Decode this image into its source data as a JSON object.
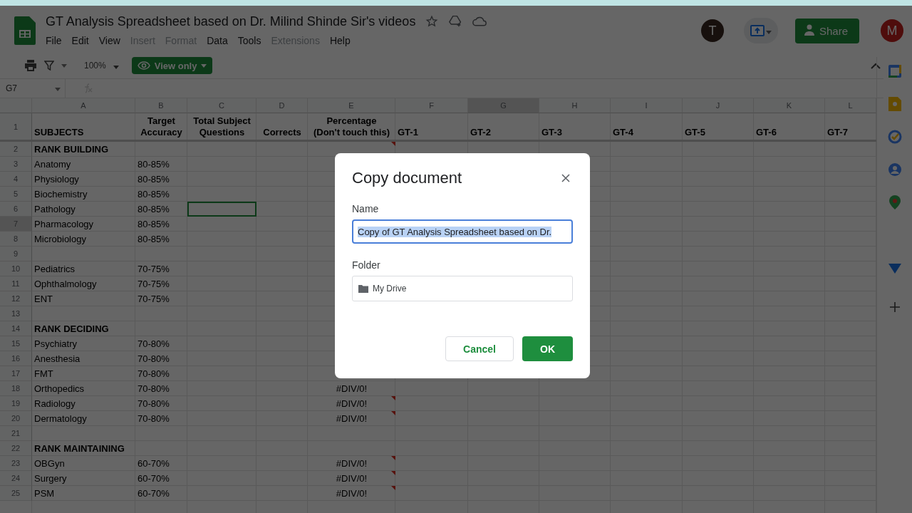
{
  "document": {
    "title": "GT Analysis Spreadsheet based on Dr. Milind Shinde Sir's videos"
  },
  "menu": [
    {
      "label": "File",
      "disabled": false
    },
    {
      "label": "Edit",
      "disabled": false
    },
    {
      "label": "View",
      "disabled": false
    },
    {
      "label": "Insert",
      "disabled": true
    },
    {
      "label": "Format",
      "disabled": true
    },
    {
      "label": "Data",
      "disabled": false
    },
    {
      "label": "Tools",
      "disabled": false
    },
    {
      "label": "Extensions",
      "disabled": true
    },
    {
      "label": "Help",
      "disabled": false
    }
  ],
  "account": {
    "collaborator_initial": "T",
    "user_initial": "M",
    "share_label": "Share"
  },
  "toolbar": {
    "zoom": "100%",
    "mode": "View only"
  },
  "name_box": "G7",
  "columns": [
    {
      "label": "A",
      "selected": false
    },
    {
      "label": "B",
      "selected": false
    },
    {
      "label": "C",
      "selected": false
    },
    {
      "label": "D",
      "selected": false
    },
    {
      "label": "E",
      "selected": false
    },
    {
      "label": "F",
      "selected": false
    },
    {
      "label": "G",
      "selected": true
    },
    {
      "label": "H",
      "selected": false
    },
    {
      "label": "I",
      "selected": false
    },
    {
      "label": "J",
      "selected": false
    },
    {
      "label": "K",
      "selected": false
    },
    {
      "label": "L",
      "selected": false
    }
  ],
  "header_row": {
    "number": "1",
    "cells": [
      "SUBJECTS",
      "Target\nAccuracy",
      "Total Subject\nQuestions",
      "Corrects",
      "Percentage\n(Don't touch this)",
      "GT-1",
      "GT-2",
      "GT-3",
      "GT-4",
      "GT-5",
      "GT-6",
      "GT-7"
    ]
  },
  "rows": [
    {
      "number": "2",
      "kind": "section",
      "a": "RANK BUILDING",
      "selected": false,
      "c_selected": false,
      "note": true
    },
    {
      "number": "3",
      "kind": "subject",
      "a": "Anatomy",
      "b": "80-85%",
      "selected": false,
      "c_selected": false,
      "note": false
    },
    {
      "number": "4",
      "kind": "subject",
      "a": "Physiology",
      "b": "80-85%",
      "selected": false,
      "c_selected": false,
      "note": false
    },
    {
      "number": "5",
      "kind": "subject",
      "a": "Biochemistry",
      "b": "80-85%",
      "selected": false,
      "c_selected": false,
      "note": false
    },
    {
      "number": "6",
      "kind": "subject",
      "a": "Pathology",
      "b": "80-85%",
      "selected": false,
      "c_selected": true,
      "note": false
    },
    {
      "number": "7",
      "kind": "subject",
      "a": "Pharmacology",
      "b": "80-85%",
      "selected": true,
      "c_selected": false,
      "note": false
    },
    {
      "number": "8",
      "kind": "subject",
      "a": "Microbiology",
      "b": "80-85%",
      "selected": false,
      "c_selected": false,
      "note": false
    },
    {
      "number": "9",
      "kind": "subject",
      "selected": false,
      "c_selected": false,
      "note": false
    },
    {
      "number": "10",
      "kind": "subject",
      "a": "Pediatrics",
      "b": "70-75%",
      "selected": false,
      "c_selected": false,
      "note": false
    },
    {
      "number": "11",
      "kind": "subject",
      "a": "Ophthalmology",
      "b": "70-75%",
      "selected": false,
      "c_selected": false,
      "note": false
    },
    {
      "number": "12",
      "kind": "subject",
      "a": "ENT",
      "b": "70-75%",
      "selected": false,
      "c_selected": false,
      "note": false
    },
    {
      "number": "13",
      "kind": "subject",
      "selected": false,
      "c_selected": false,
      "note": false
    },
    {
      "number": "14",
      "kind": "section",
      "a": "RANK DECIDING",
      "selected": false,
      "c_selected": false,
      "note": false
    },
    {
      "number": "15",
      "kind": "subject",
      "a": "Psychiatry",
      "b": "70-80%",
      "selected": false,
      "c_selected": false,
      "note": false
    },
    {
      "number": "16",
      "kind": "subject",
      "a": "Anesthesia",
      "b": "70-80%",
      "selected": false,
      "c_selected": false,
      "note": false
    },
    {
      "number": "17",
      "kind": "subject",
      "a": "FMT",
      "b": "70-80%",
      "selected": false,
      "c_selected": false,
      "note": false
    },
    {
      "number": "18",
      "kind": "subject",
      "a": "Orthopedics",
      "b": "70-80%",
      "e": "#DIV/0!",
      "selected": false,
      "c_selected": false,
      "note": false
    },
    {
      "number": "19",
      "kind": "subject",
      "a": "Radiology",
      "b": "70-80%",
      "e": "#DIV/0!",
      "selected": false,
      "c_selected": false,
      "note": true
    },
    {
      "number": "20",
      "kind": "subject",
      "a": "Dermatology",
      "b": "70-80%",
      "e": "#DIV/0!",
      "selected": false,
      "c_selected": false,
      "note": true
    },
    {
      "number": "21",
      "kind": "subject",
      "selected": false,
      "c_selected": false,
      "note": false
    },
    {
      "number": "22",
      "kind": "section",
      "a": "RANK MAINTAINING",
      "selected": false,
      "c_selected": false,
      "note": false
    },
    {
      "number": "23",
      "kind": "subject",
      "a": "OBGyn",
      "b": "60-70%",
      "e": "#DIV/0!",
      "selected": false,
      "c_selected": false,
      "note": true
    },
    {
      "number": "24",
      "kind": "subject",
      "a": "Surgery",
      "b": "60-70%",
      "e": "#DIV/0!",
      "selected": false,
      "c_selected": false,
      "note": true
    },
    {
      "number": "25",
      "kind": "subject",
      "a": "PSM",
      "b": "60-70%",
      "e": "#DIV/0!",
      "selected": false,
      "c_selected": false,
      "note": true
    }
  ],
  "dialog": {
    "title": "Copy document",
    "name_label": "Name",
    "name_value": "Copy of GT Analysis Spreadsheet based on Dr.",
    "name_selected": true,
    "folder_label": "Folder",
    "folder": "My Drive",
    "buttons": [
      "Cancel",
      "OK"
    ]
  }
}
